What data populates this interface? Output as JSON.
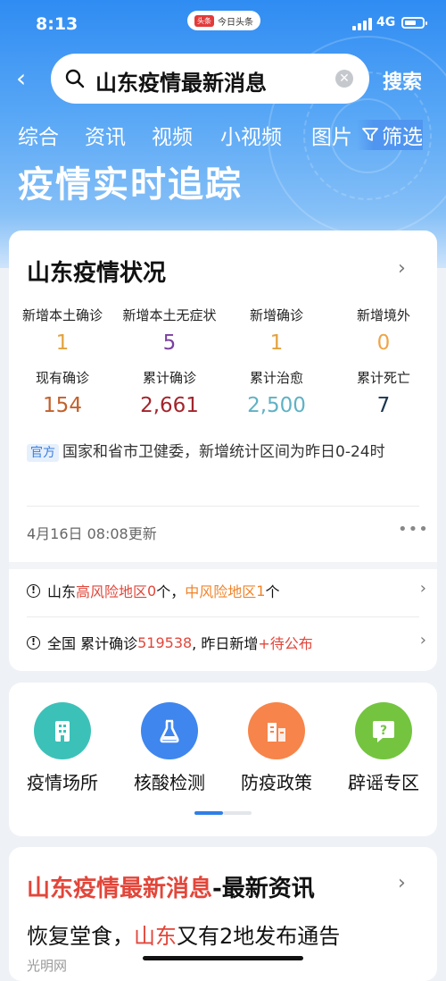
{
  "status_bar": {
    "time": "8:13",
    "app_badge_logo": "头条",
    "app_badge_text": "今日头条",
    "network": "4G"
  },
  "search": {
    "back_icon": "chevron-left-icon",
    "query": "山东疫情最新消息",
    "button": "搜索"
  },
  "tabs": [
    "综合",
    "资讯",
    "视频",
    "小视频",
    "图片"
  ],
  "filter_label": "筛选",
  "hero_title": "疫情实时追踪",
  "status_card": {
    "title": "山东疫情状况",
    "stats_row1": [
      {
        "label": "新增本土确诊",
        "value": "1",
        "color": "#e3a23c"
      },
      {
        "label": "新增本土无症状",
        "value": "5",
        "color": "#7a3fa0"
      },
      {
        "label": "新增确诊",
        "value": "1",
        "color": "#e3a23c"
      },
      {
        "label": "新增境外",
        "value": "0",
        "color": "#f0a446"
      }
    ],
    "stats_row2": [
      {
        "label": "现有确诊",
        "value": "154",
        "color": "#c4602b"
      },
      {
        "label": "累计确诊",
        "value": "2,661",
        "color": "#a3242c"
      },
      {
        "label": "累计治愈",
        "value": "2,500",
        "color": "#5fb2c4"
      },
      {
        "label": "累计死亡",
        "value": "7",
        "color": "#1c3550"
      }
    ],
    "official_tag": "官方",
    "official_text": "国家和省市卫健委，新增统计区间为昨日0-24时",
    "updated": "4月16日 08:08更新",
    "more": "•••"
  },
  "alerts": {
    "row1": {
      "prefix": "山东",
      "high": "高风险地区",
      "high_n": "0",
      "mid_sep": "个，",
      "mid": "中风险地区",
      "mid_n": "1",
      "suffix": "个"
    },
    "row2": {
      "prefix": "全国 累计确诊",
      "total": "519538",
      "mid": ", 昨日新增",
      "plus": "+待公布"
    }
  },
  "services": [
    {
      "label": "疫情场所",
      "icon": "building-icon",
      "color": "#3cc1b8"
    },
    {
      "label": "核酸检测",
      "icon": "flask-icon",
      "color": "#3f86ee"
    },
    {
      "label": "防疫政策",
      "icon": "policy-building-icon",
      "color": "#f7844a"
    },
    {
      "label": "辟谣专区",
      "icon": "question-icon",
      "color": "#74c440"
    }
  ],
  "news_card": {
    "title_red": "山东疫情最新消息",
    "title_rest": "-最新资讯",
    "headline_pre": "恢复堂食，",
    "headline_red": "山东",
    "headline_post": "又有2地发布通告",
    "meta": "光明网"
  }
}
